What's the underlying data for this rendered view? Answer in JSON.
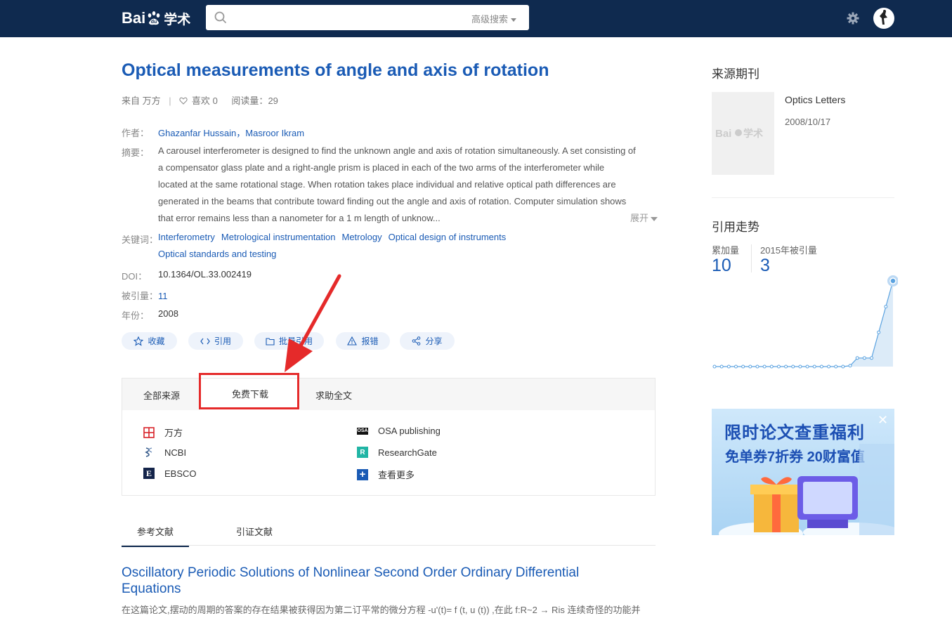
{
  "header": {
    "logo_text": "Bai",
    "logo_du": "du",
    "logo_suffix": "学术",
    "search_value": "",
    "search_placeholder": "",
    "advanced_search": "高级搜索"
  },
  "paper": {
    "title": "Optical measurements of angle and axis of rotation",
    "source_prefix": "来自",
    "source_name": "万方",
    "likes_label": "喜欢",
    "likes_count": "0",
    "reads_label": "阅读量：",
    "reads_count": "29",
    "author_label": "作者：",
    "authors": "Ghazanfar Hussain，Masroor Ikram",
    "abstract_label": "摘要：",
    "abstract": "A carousel interferometer is designed to find the unknown angle and axis of rotation simultaneously. A set consisting of a compensator glass plate and a right-angle prism is placed in each of the two arms of the interferometer while located at the same rotational stage. When rotation takes place individual and relative optical path differences are generated in the beams that contribute toward finding out the angle and axis of rotation. Computer simulation shows that error remains less than a nanometer for a 1 m length of unknow...",
    "expand_label": "展开",
    "keywords_label": "关键词：",
    "keywords": [
      "Interferometry",
      "Metrological instrumentation",
      "Metrology",
      "Optical design of instruments",
      "Optical standards and testing"
    ],
    "doi_label": "DOI：",
    "doi": "10.1364/OL.33.002419",
    "cited_label": "被引量：",
    "cited": "11",
    "year_label": "年份：",
    "year": "2008"
  },
  "actions": {
    "collect": "收藏",
    "cite": "引用",
    "batch_cite": "批量引用",
    "report": "报错",
    "share": "分享"
  },
  "sources": {
    "tabs": [
      "全部来源",
      "免费下载",
      "求助全文"
    ],
    "items": [
      {
        "name": "万方"
      },
      {
        "name": "OSA publishing"
      },
      {
        "name": "NCBI"
      },
      {
        "name": "ResearchGate"
      },
      {
        "name": "EBSCO"
      },
      {
        "name": "查看更多"
      }
    ]
  },
  "references": {
    "tabs": [
      "参考文献",
      "引证文献"
    ],
    "first_title": "Oscillatory Periodic Solutions of Nonlinear Second Order Ordinary Differential Equations",
    "first_abstract": "在这篇论文,摆动的周期的答案的存在结果被获得因为第二订平常的微分方程 -u'(t)= f (t, u (t)) ,在此 f:R~2 → Ris 连续奇怪的功能并"
  },
  "sidebar": {
    "journal_heading": "来源期刊",
    "journal_name": "Optics Letters",
    "journal_date": "2008/10/17",
    "trend_heading": "引用走势",
    "total_label": "累加量",
    "total_value": "10",
    "year_label": "2015年被引量",
    "year_value": "3"
  },
  "chart_data": {
    "type": "area",
    "values": [
      0,
      0,
      0,
      0,
      0,
      0,
      0,
      0,
      0,
      0,
      0,
      0,
      0,
      0,
      0,
      0,
      0,
      0,
      0,
      0.1,
      1,
      1,
      1,
      4,
      7,
      10
    ],
    "colors": {
      "line": "#5aa2e0",
      "fill": "#dcebf8",
      "highlight": "#5aa2e0"
    }
  },
  "ad": {
    "line1": "限时论文查重福利",
    "line2": "免单券7折券 20财富值",
    "close": "✕"
  }
}
